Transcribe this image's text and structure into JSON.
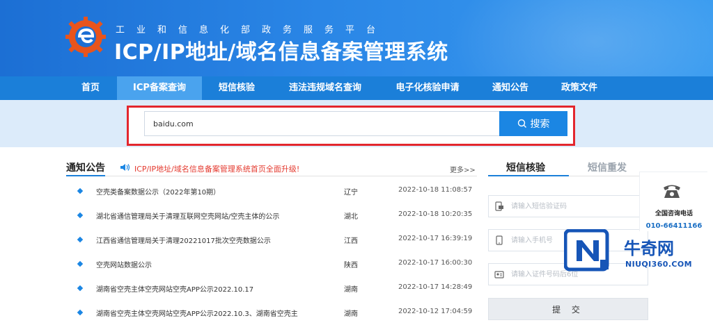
{
  "header": {
    "subtitle": "工业和信息化部政务服务平台",
    "title": "ICP/IP地址/域名信息备案管理系统"
  },
  "nav": {
    "items": [
      {
        "label": "首页"
      },
      {
        "label": "ICP备案查询",
        "active": true
      },
      {
        "label": "短信核验"
      },
      {
        "label": "违法违规域名查询"
      },
      {
        "label": "电子化核验申请"
      },
      {
        "label": "通知公告"
      },
      {
        "label": "政策文件"
      }
    ]
  },
  "search": {
    "value": "baidu.com",
    "button_label": "搜索"
  },
  "notices": {
    "title": "通知公告",
    "marquee": "ICP/IP地址/域名信息备案管理系统首页全面升级!",
    "more": "更多>>",
    "rows": [
      {
        "title": "空壳类备案数据公示（2022年第10期）",
        "province": "辽宁",
        "date": "2022-10-18 11:08:57"
      },
      {
        "title": "湖北省通信管理局关于清理互联网空壳网站/空壳主体的公示",
        "province": "湖北",
        "date": "2022-10-18 10:20:35"
      },
      {
        "title": "江西省通信管理局关于清理20221017批次空壳数据公示",
        "province": "江西",
        "date": "2022-10-17 16:39:19"
      },
      {
        "title": "空壳网站数据公示",
        "province": "陕西",
        "date": "2022-10-17 16:00:30"
      },
      {
        "title": "湖南省空壳主体空壳网站空壳APP公示2022.10.17",
        "province": "湖南",
        "date": "2022-10-17 14:28:49"
      },
      {
        "title": "湖南省空壳主体空壳网站空壳APP公示2022.10.3、湖南省空壳主",
        "province": "湖南",
        "date": "2022-10-12 17:04:59"
      }
    ]
  },
  "sms": {
    "tab_verify": "短信核验",
    "tab_resend": "短信重发",
    "code_placeholder": "请输入短信验证码",
    "phone_placeholder": "请输入手机号",
    "id_placeholder": "请输入证件号码后6位",
    "submit_label": "提 交"
  },
  "hotline": {
    "label": "全国咨询电话",
    "number": "010-66411166"
  },
  "watermark": {
    "name": "牛奇网",
    "domain": "NIUQI360.COM"
  },
  "colors": {
    "header_blue": "#2a86e6",
    "nav_blue": "#1b7fd9",
    "nav_active": "#4aa3ee",
    "search_button": "#1b86e3",
    "highlight_red": "#e3262d",
    "marquee_red": "#e43a2f"
  },
  "icons": [
    "gear-logo-icon",
    "speaker-icon",
    "search-icon",
    "sms-code-icon",
    "mobile-phone-icon",
    "id-card-icon",
    "telephone-icon",
    "niuqi-logo-icon"
  ]
}
